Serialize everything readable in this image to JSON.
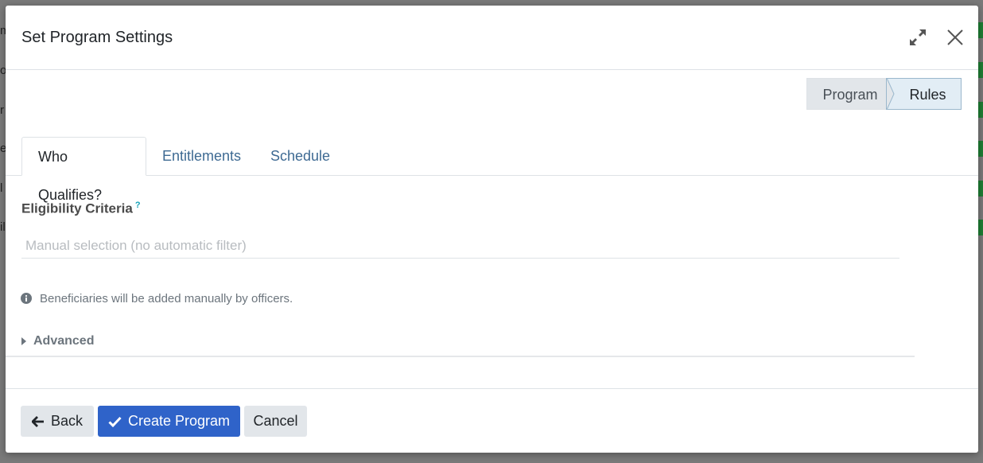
{
  "modal": {
    "title": "Set Program Settings"
  },
  "steps": {
    "program": "Program",
    "rules": "Rules"
  },
  "tabs": [
    {
      "label": "Who Qualifies?",
      "active": true
    },
    {
      "label": "Entitlements",
      "active": false
    },
    {
      "label": "Schedule",
      "active": false
    }
  ],
  "eligibility": {
    "label": "Eligibility Criteria",
    "help": "?",
    "value": "",
    "placeholder": "Manual selection (no automatic filter)"
  },
  "info": {
    "icon": "info-circle-icon",
    "text": "Beneficiaries will be added manually by officers."
  },
  "advanced": {
    "label": "Advanced",
    "icon": "caret-right-icon"
  },
  "footer": {
    "back_label": "Back",
    "create_label": "Create Program",
    "cancel_label": "Cancel"
  },
  "colors": {
    "primary": "#2f63c9",
    "tab_link": "#3e6a93",
    "help": "#17a2b8",
    "muted": "#6c757d"
  },
  "background": {
    "row_chars": [
      "m",
      "o",
      "r",
      "e",
      "l",
      "il"
    ]
  }
}
